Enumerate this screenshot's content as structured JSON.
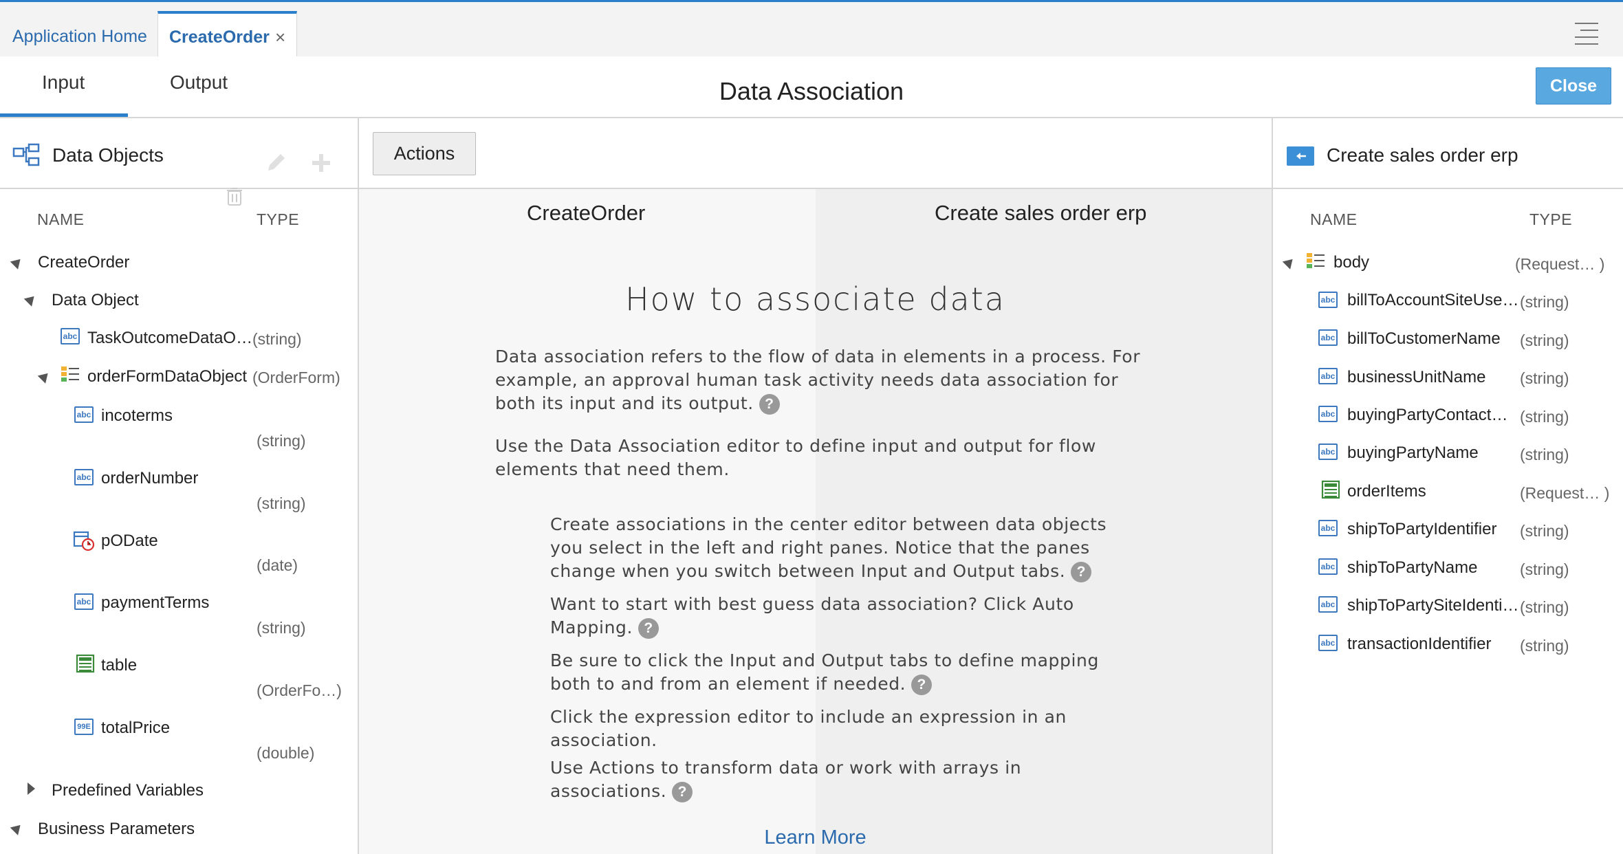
{
  "tabs": {
    "home_label": "Application Home",
    "active_label": "CreateOrder",
    "close_glyph": "×"
  },
  "header": {
    "input_tab": "Input",
    "output_tab": "Output",
    "title": "Data Association",
    "close_button": "Close"
  },
  "left": {
    "title": "Data Objects",
    "col_name": "NAME",
    "col_type": "TYPE",
    "rows": [
      {
        "label": "CreateOrder",
        "type": ""
      },
      {
        "label": "Data Object",
        "type": ""
      },
      {
        "label": "TaskOutcomeDataO…",
        "type": "(string)"
      },
      {
        "label": "orderFormDataObject",
        "type": "(OrderForm)"
      },
      {
        "label": "incoterms",
        "type": "(string)"
      },
      {
        "label": "orderNumber",
        "type": "(string)"
      },
      {
        "label": "pODate",
        "type": "(date)"
      },
      {
        "label": "paymentTerms",
        "type": "(string)"
      },
      {
        "label": "table",
        "type": "(OrderFo…)"
      },
      {
        "label": "totalPrice",
        "type": "(double)"
      },
      {
        "label": "Predefined Variables",
        "type": ""
      },
      {
        "label": "Business Parameters",
        "type": ""
      }
    ]
  },
  "middle": {
    "actions_button": "Actions",
    "col_left": "CreateOrder",
    "col_right": "Create sales order erp",
    "heading": "How to associate data",
    "para1": "Data association refers to the flow of data in elements in a process. For example, an approval human task activity needs data association for both its input and its output.",
    "para2": "Use the Data Association editor to define input and output for flow elements that need them.",
    "tips": [
      "Create associations in the center editor between data objects you select in the left and right panes. Notice that the panes change when you switch between Input and Output tabs.",
      "Want to start with best guess data association? Click Auto Mapping.",
      "Be sure to click the Input and Output tabs to define mapping both to and from an element if needed.",
      "Click the expression editor to include an expression in an association.",
      "Use Actions to transform data or work with arrays in associations."
    ],
    "help_glyph": "?",
    "learn_more": "Learn More"
  },
  "right": {
    "title": "Create sales order erp",
    "col_name": "NAME",
    "col_type": "TYPE",
    "rows": [
      {
        "label": "body",
        "type": "(Request… )"
      },
      {
        "label": "billToAccountSiteUse…",
        "type": "(string)"
      },
      {
        "label": "billToCustomerName",
        "type": "(string)"
      },
      {
        "label": "businessUnitName",
        "type": "(string)"
      },
      {
        "label": "buyingPartyContact…",
        "type": "(string)"
      },
      {
        "label": "buyingPartyName",
        "type": "(string)"
      },
      {
        "label": "orderItems",
        "type": "(Request… )"
      },
      {
        "label": "shipToPartyIdentifier",
        "type": "(string)"
      },
      {
        "label": "shipToPartyName",
        "type": "(string)"
      },
      {
        "label": "shipToPartySiteIdenti…",
        "type": "(string)"
      },
      {
        "label": "transactionIdentifier",
        "type": "(string)"
      }
    ]
  },
  "icons": {
    "abc": "abc",
    "num": "99E",
    "data_objects": "data-objects-icon",
    "service": "service-icon"
  },
  "colors": {
    "accent": "#2a7fcb",
    "close_button": "#5aa8e0",
    "link": "#2a6aad"
  }
}
